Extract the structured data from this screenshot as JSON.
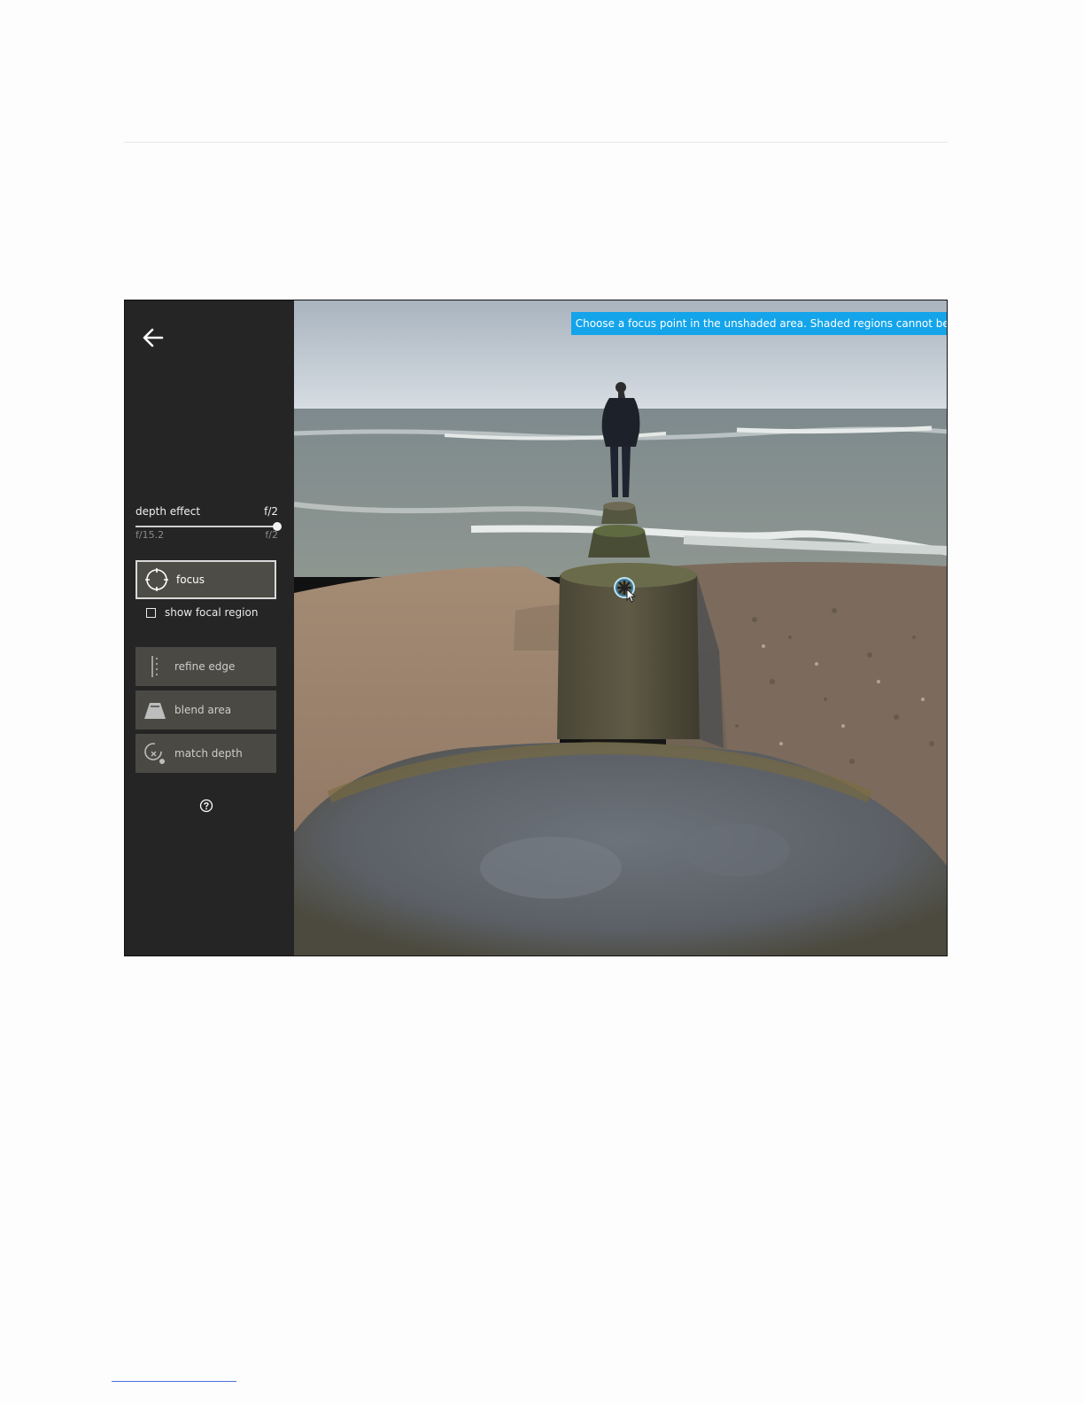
{
  "sidebar": {
    "back_icon": "arrow-left-icon",
    "depth_effect": {
      "label": "depth effect",
      "value": "f/2",
      "min_label": "f/15.2",
      "max_label": "f/2",
      "slider_fraction": 1.0
    },
    "tools": {
      "focus": {
        "label": "focus",
        "icon": "crosshair-circle-icon",
        "active": true
      },
      "show_focal_region": {
        "label": "show focal region",
        "checked": false
      },
      "refine_edge": {
        "label": "refine edge",
        "icon": "dotted-edge-icon"
      },
      "blend_area": {
        "label": "blend area",
        "icon": "trapezoid-icon"
      },
      "match_depth": {
        "label": "match depth",
        "icon": "match-depth-icon"
      }
    },
    "help_icon": "question-circle-icon"
  },
  "canvas": {
    "hint": "Choose a focus point in the unshaded area. Shaded regions cannot be adjusted.",
    "hint_color": "#14a4ea",
    "cursor_icon": "focus-target-cursor-icon"
  }
}
